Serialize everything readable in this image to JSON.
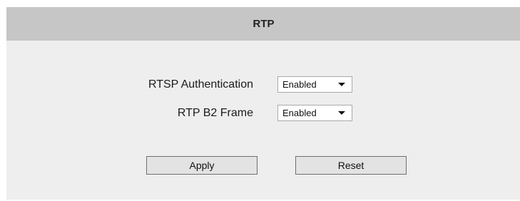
{
  "header": {
    "title": "RTP"
  },
  "form": {
    "rows": [
      {
        "label": "RTSP Authentication",
        "value": "Enabled"
      },
      {
        "label": "RTP B2 Frame",
        "value": "Enabled"
      }
    ]
  },
  "actions": {
    "apply_label": "Apply",
    "reset_label": "Reset"
  },
  "icons": {
    "dropdown": "chevron-down-icon"
  },
  "colors": {
    "header_background": "#c6c6c6",
    "panel_background": "#eeeeee"
  }
}
